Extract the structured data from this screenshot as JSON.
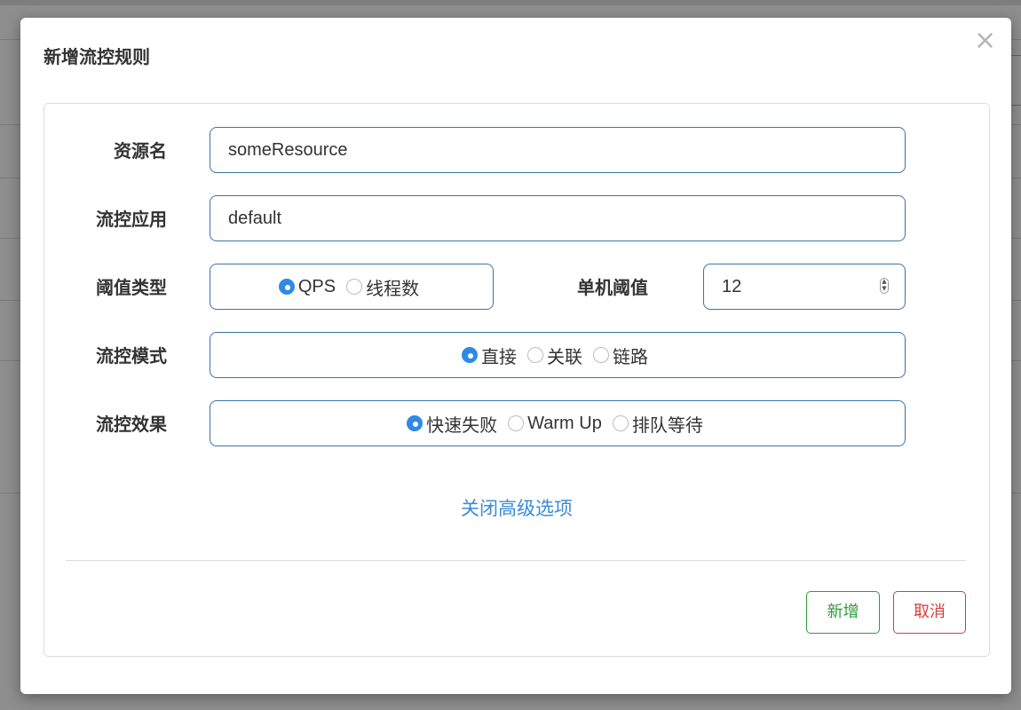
{
  "modal": {
    "title": "新增流控规则",
    "close_symbol": "×"
  },
  "form": {
    "resource": {
      "label": "资源名",
      "value": "someResource"
    },
    "app": {
      "label": "流控应用",
      "value": "default"
    },
    "threshold_type": {
      "label": "阈值类型",
      "options": [
        {
          "label": "QPS",
          "checked": true
        },
        {
          "label": "线程数",
          "checked": false
        }
      ]
    },
    "threshold": {
      "label": "单机阈值",
      "value": "12"
    },
    "mode": {
      "label": "流控模式",
      "options": [
        {
          "label": "直接",
          "checked": true
        },
        {
          "label": "关联",
          "checked": false
        },
        {
          "label": "链路",
          "checked": false
        }
      ]
    },
    "effect": {
      "label": "流控效果",
      "options": [
        {
          "label": "快速失败",
          "checked": true
        },
        {
          "label": "Warm Up",
          "checked": false
        },
        {
          "label": "排队等待",
          "checked": false
        }
      ]
    },
    "advanced_link": "关闭高级选项"
  },
  "footer": {
    "add_label": "新增",
    "cancel_label": "取消"
  },
  "colors": {
    "primary_border": "#3a74a6",
    "radio_checked": "#2f8ae5",
    "link": "#3a8bd6",
    "success": "#2e9c3c",
    "danger": "#d43f3a"
  }
}
